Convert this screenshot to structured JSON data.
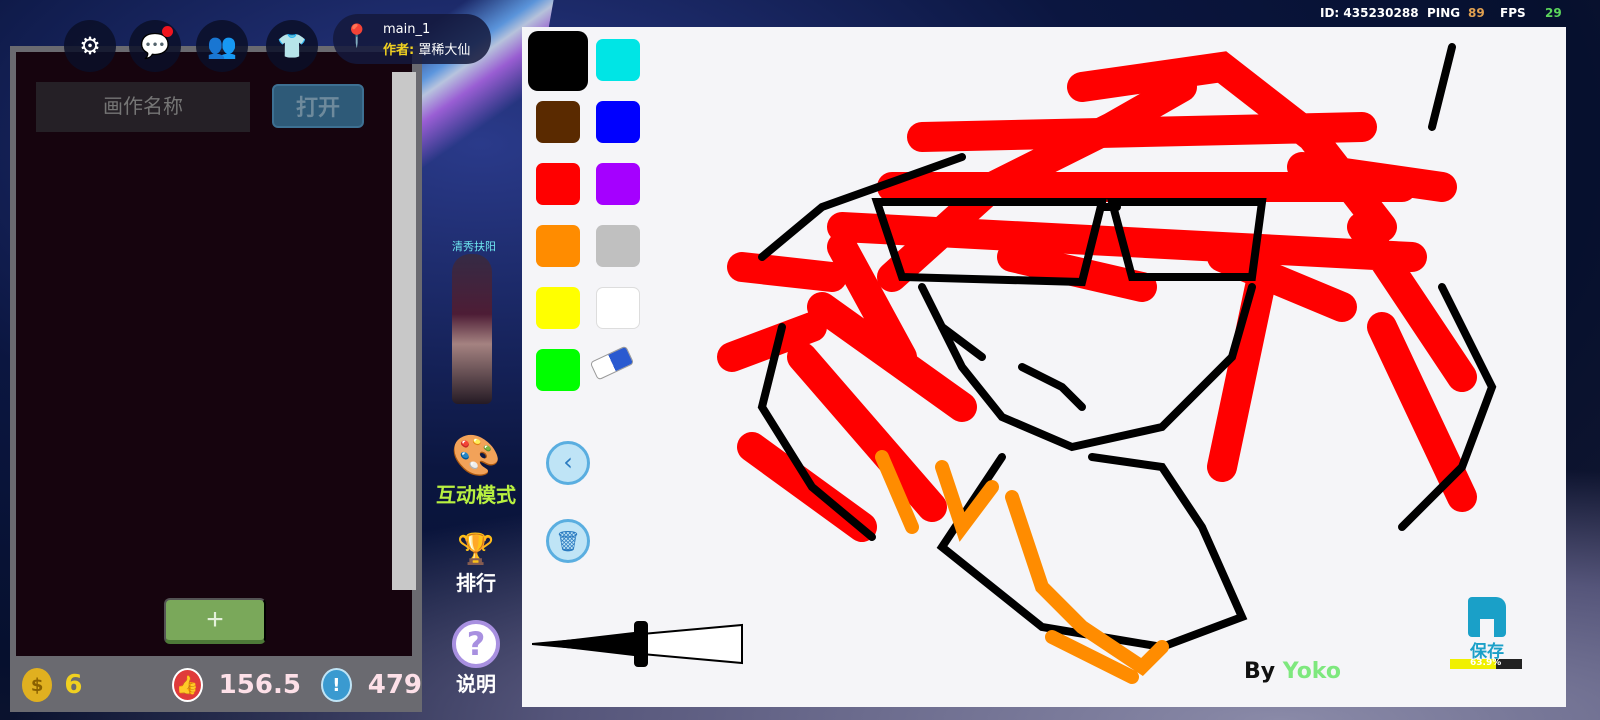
{
  "hud": {
    "id": "ID: 435230288",
    "ping_label": "PING",
    "ping": "89",
    "fps_label": "FPS",
    "fps": "29",
    "ping_color": "#e0a050",
    "fps_color": "#5cd65c"
  },
  "top": {
    "map_name": "main_1",
    "author_label": "作者:",
    "author": "罩稀大仙"
  },
  "panel": {
    "name_placeholder": "画作名称",
    "open": "打开",
    "add": "+",
    "coins": "6",
    "likes": "156.5",
    "reports": "479"
  },
  "player": {
    "name": "清秀扶阳"
  },
  "side": {
    "interact": "互动模式",
    "rank": "排行",
    "help": "说明"
  },
  "canvas": {
    "colors": [
      "#000000",
      "#00e5e5",
      "#5a2a00",
      "#0000ff",
      "#ff0000",
      "#a500ff",
      "#ff8c00",
      "#c0c0c0",
      "#ffff00",
      "#ffffff",
      "#00ff00"
    ],
    "signature_by": "By",
    "signature_name": "Yoko",
    "save": "保存",
    "progress_text": "63.9%",
    "progress": 63.9
  }
}
